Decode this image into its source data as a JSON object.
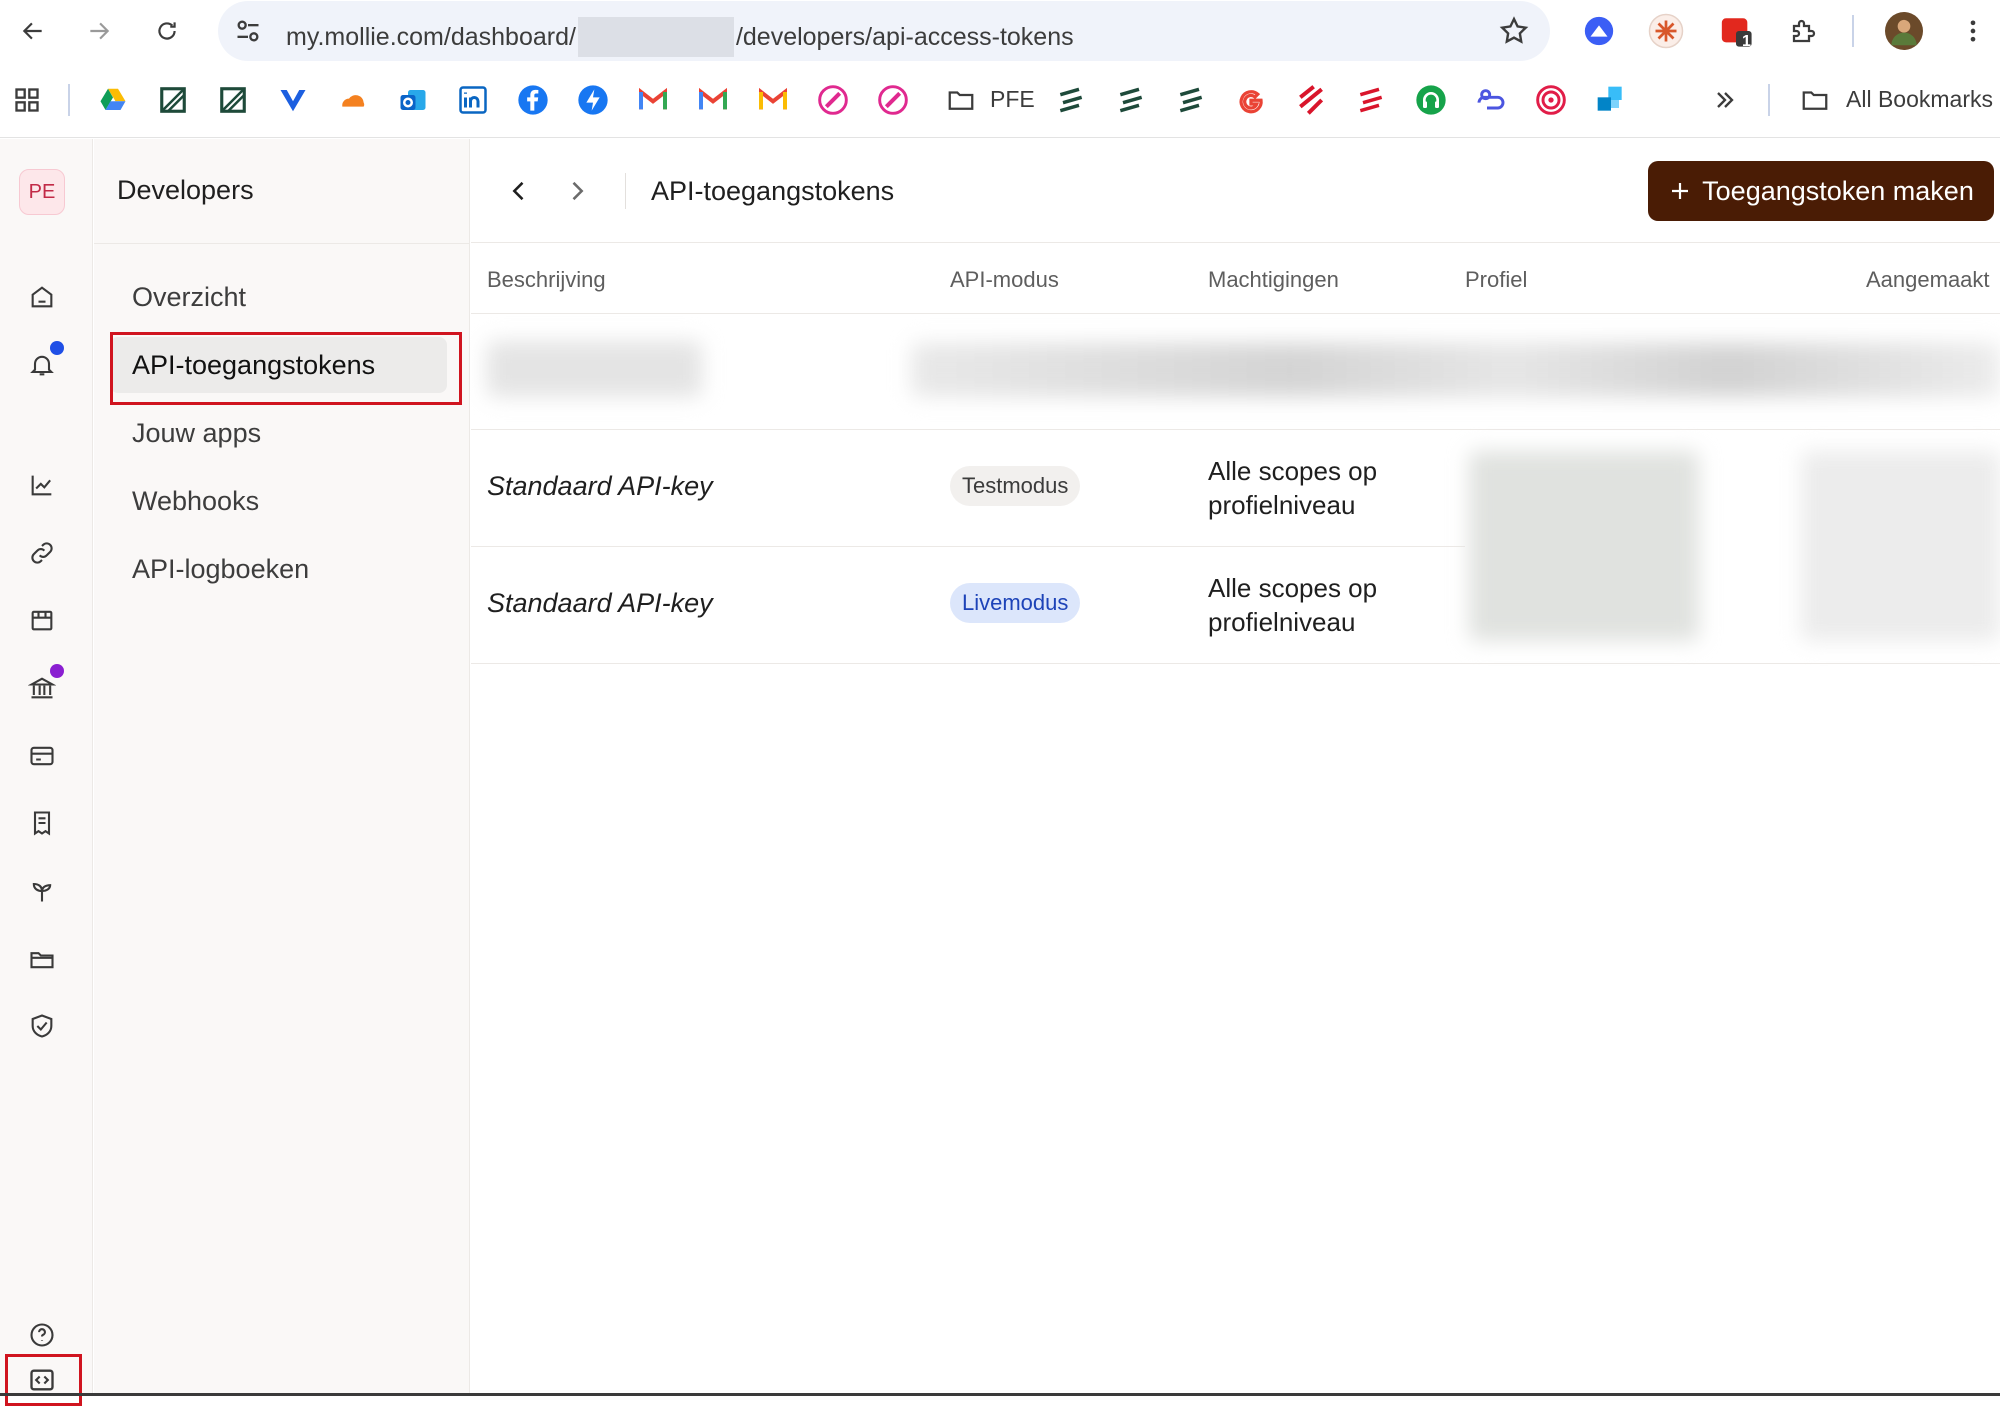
{
  "browser": {
    "url_prefix": "my.mollie.com/dashboard/",
    "url_suffix": "/developers/api-access-tokens",
    "extension_badge": "1"
  },
  "bookmarks": {
    "folder_pfe": "PFE",
    "all_bookmarks": "All Bookmarks"
  },
  "rail": {
    "avatar_initials": "PE",
    "dot_colors": {
      "notifications": "#1f4fe6",
      "bank": "#8a1fd1"
    }
  },
  "subnav": {
    "title": "Developers",
    "items": [
      {
        "label": "Overzicht"
      },
      {
        "label": "API-toegangstokens",
        "active": true
      },
      {
        "label": "Jouw apps"
      },
      {
        "label": "Webhooks"
      },
      {
        "label": "API-logboeken"
      }
    ]
  },
  "main": {
    "page_title": "API-toegangstokens",
    "create_button": "Toegangstoken maken",
    "columns": [
      "Beschrijving",
      "API-modus",
      "Machtigingen",
      "Profiel",
      "Aangemaakt"
    ],
    "rows": [
      {
        "description": "Standaard API-key",
        "mode": "Testmodus",
        "permissions": "Alle scopes op profielniveau"
      },
      {
        "description": "Standaard API-key",
        "mode": "Livemodus",
        "permissions": "Alle scopes op profielniveau"
      }
    ]
  },
  "colors": {
    "primary_button": "#4a1c05",
    "annotation": "#d0141f",
    "live_pill_bg": "#dce6fb",
    "live_pill_text": "#1d43b8"
  }
}
